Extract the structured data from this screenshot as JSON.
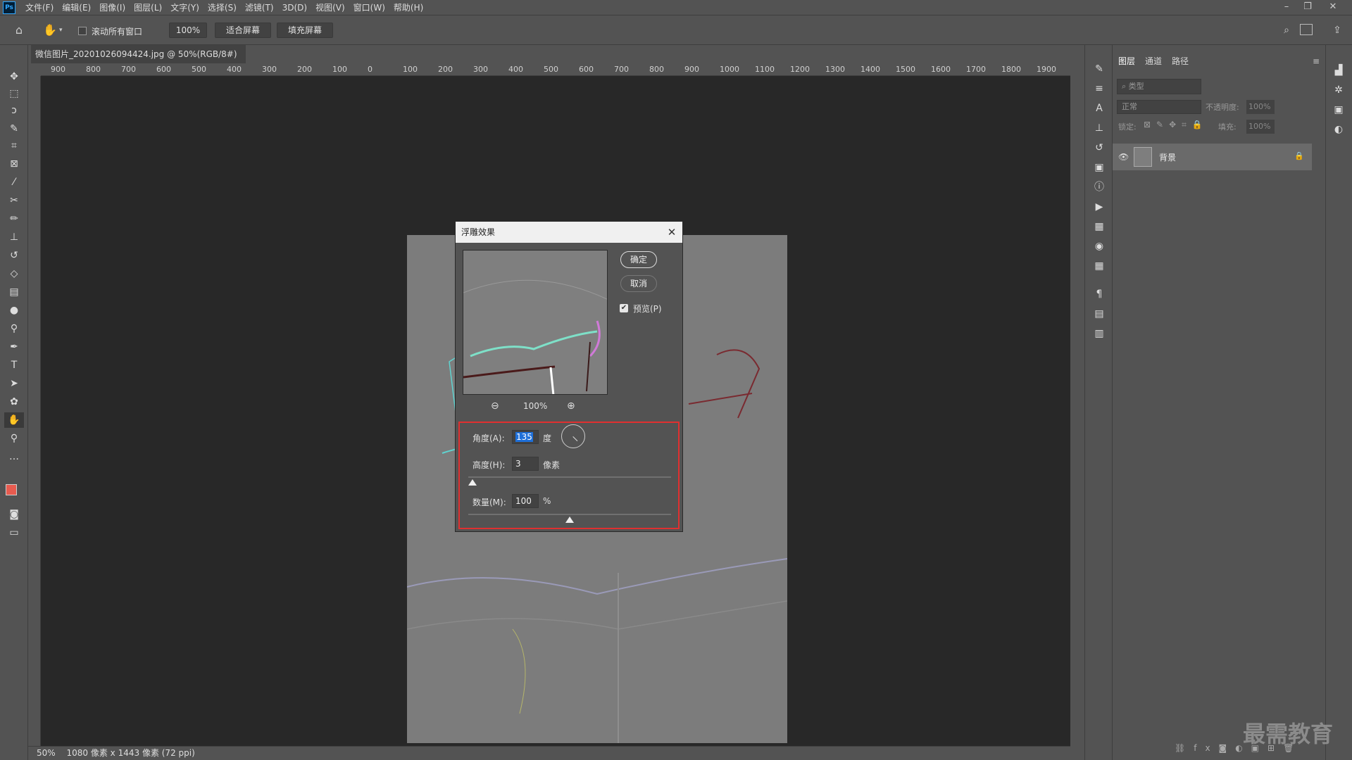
{
  "app": {
    "logo": "Ps"
  },
  "menu": [
    "文件(F)",
    "编辑(E)",
    "图像(I)",
    "图层(L)",
    "文字(Y)",
    "选择(S)",
    "滤镜(T)",
    "3D(D)",
    "视图(V)",
    "窗口(W)",
    "帮助(H)"
  ],
  "window_controls": {
    "minimize": "–",
    "restore": "❐",
    "close": "✕"
  },
  "options": {
    "scroll_all_label": "滚动所有窗口",
    "zoom_label": "100%",
    "fit_label": "适合屏幕",
    "fill_label": "填充屏幕"
  },
  "document": {
    "tab_title": "微信图片_20201026094424.jpg @ 50%(RGB/8#)",
    "tab_close": "×"
  },
  "ruler": {
    "h_labels": [
      "900",
      "800",
      "700",
      "600",
      "500",
      "400",
      "300",
      "200",
      "100",
      "0",
      "100",
      "200",
      "300",
      "400",
      "500",
      "600",
      "700",
      "800",
      "900",
      "1000",
      "1100",
      "1200",
      "1300",
      "1400",
      "1500",
      "1600",
      "1700",
      "1800",
      "1900"
    ]
  },
  "status": {
    "zoom": "50%",
    "info": "1080 像素 x 1443 像素 (72 ppi)"
  },
  "layers_panel": {
    "tabs": [
      "图层",
      "通道",
      "路径"
    ],
    "filter_placeholder": "类型",
    "blend_mode": "正常",
    "opacity_label": "不透明度:",
    "opacity_value": "100%",
    "lock_label": "锁定:",
    "fill_label": "填充:",
    "fill_value": "100%",
    "layer_name": "背景"
  },
  "dialog": {
    "title": "浮雕效果",
    "ok_label": "确定",
    "cancel_label": "取消",
    "preview_label": "预览(P)",
    "preview_checked": true,
    "zoom_value": "100%",
    "angle_label": "角度(A):",
    "angle_value": "135",
    "angle_unit": "度",
    "height_label": "高度(H):",
    "height_value": "3",
    "height_unit": "像素",
    "amount_label": "数量(M):",
    "amount_value": "100",
    "amount_unit": "%",
    "height_slider_fraction": 0.02,
    "amount_slider_fraction": 0.5,
    "highlight_color": "#e03030"
  },
  "watermark": "最需教育"
}
